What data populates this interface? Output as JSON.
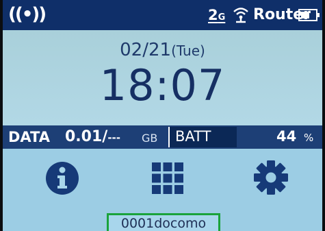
{
  "status_bar": {
    "broadcast_glyph": "((•))",
    "network_type": "2",
    "network_suffix": "G",
    "mode": "Router",
    "icons": [
      "broadcast-icon",
      "wifi-icon",
      "battery-icon"
    ]
  },
  "clock": {
    "date": "02/21",
    "weekday": "(Tue)",
    "time": "18:07"
  },
  "info_bar": {
    "data_label": "DATA",
    "data_value": "0.01/",
    "data_limit": "---",
    "data_unit": "GB",
    "battery_label": "BATT",
    "battery_value": "44",
    "battery_unit": "%"
  },
  "icon_row": {
    "icons": [
      "info-icon",
      "apps-grid-icon",
      "settings-gear-icon"
    ]
  },
  "carrier": {
    "name": "0001docomo"
  },
  "colors": {
    "status_bar": "#0f2f69",
    "screen_bg": "#a9d6ea",
    "icon": "#163a78",
    "carrier_border": "#1aa33b"
  }
}
